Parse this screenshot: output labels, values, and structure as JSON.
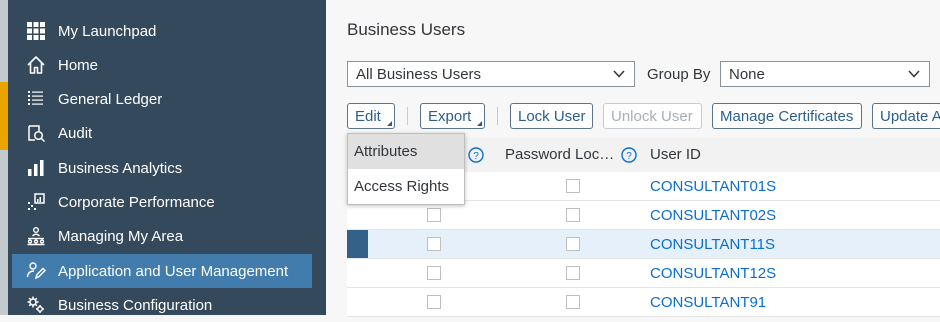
{
  "sidebar": {
    "items": [
      {
        "label": "My Launchpad",
        "icon": "grid-icon"
      },
      {
        "label": "Home",
        "icon": "home-icon"
      },
      {
        "label": "General Ledger",
        "icon": "list-icon"
      },
      {
        "label": "Audit",
        "icon": "audit-icon"
      },
      {
        "label": "Business Analytics",
        "icon": "bar-chart-icon"
      },
      {
        "label": "Corporate Performance",
        "icon": "performance-icon"
      },
      {
        "label": "Managing My Area",
        "icon": "org-chart-icon"
      },
      {
        "label": "Application and User Management",
        "icon": "user-edit-icon"
      },
      {
        "label": "Business Configuration",
        "icon": "gears-icon"
      }
    ],
    "active_index": 7
  },
  "main": {
    "title": "Business Users",
    "filter": {
      "value": "All Business Users"
    },
    "group_by": {
      "label": "Group By",
      "value": "None"
    },
    "toolbar": {
      "edit": "Edit",
      "export": "Export",
      "lock_user": "Lock User",
      "unlock_user": "Unlock User",
      "manage_certificates": "Manage Certificates",
      "update": "Update A"
    },
    "table": {
      "columns": {
        "password_locked": "Password Loc…",
        "user_id": "User ID"
      },
      "rows": [
        {
          "user_id": "CONSULTANT01S"
        },
        {
          "user_id": "CONSULTANT02S"
        },
        {
          "user_id": "CONSULTANT11S"
        },
        {
          "user_id": "CONSULTANT12S"
        },
        {
          "user_id": "CONSULTANT91"
        }
      ],
      "selected_row": 2
    },
    "edit_menu": {
      "items": [
        "Attributes",
        "Access Rights"
      ]
    }
  },
  "colors": {
    "sidebar_bg": "#34495c",
    "sidebar_active": "#427cac",
    "accent": "#e9a402",
    "link": "#0a6ed1"
  }
}
